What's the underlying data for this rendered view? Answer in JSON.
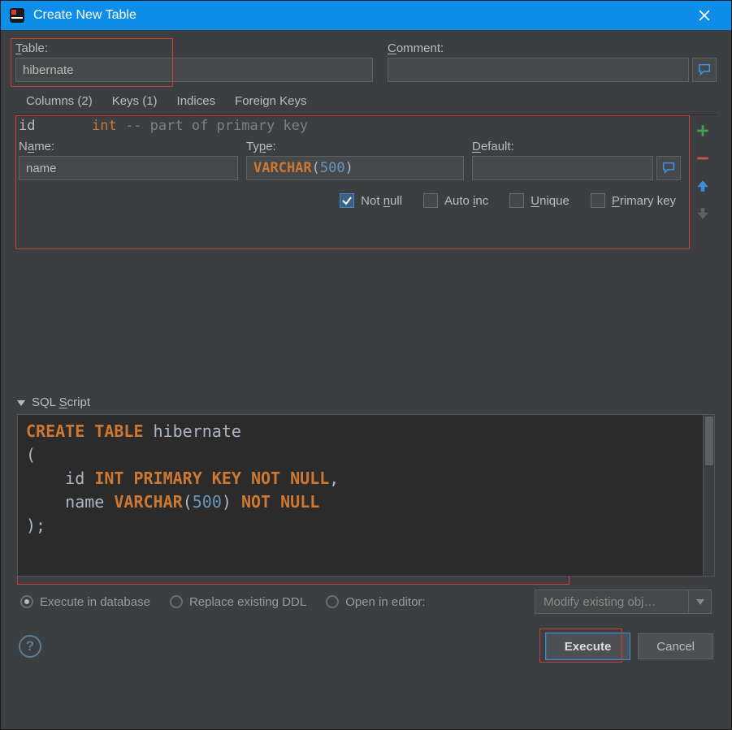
{
  "window": {
    "title": "Create New Table"
  },
  "form": {
    "table_label": "Table:",
    "table_value": "hibernate",
    "comment_label": "Comment:",
    "comment_value": ""
  },
  "tabs": {
    "columns": "Columns (2)",
    "keys": "Keys (1)",
    "indices": "Indices",
    "foreign_keys": "Foreign Keys"
  },
  "hint": {
    "col_name": "id",
    "col_type": "int",
    "col_comment": "-- part of primary key"
  },
  "colfields": {
    "name_label": "Name:",
    "name_value": "name",
    "type_label": "Type:",
    "type_value_html": "VARCHAR(500)",
    "type_kw": "VARCHAR",
    "type_open": "(",
    "type_num": "500",
    "type_close": ")",
    "default_label": "Default:",
    "default_value": ""
  },
  "checks": {
    "not_null": "Not null",
    "auto_inc": "Auto inc",
    "unique": "Unique",
    "primary_key": "Primary key"
  },
  "sql": {
    "header": "SQL Script",
    "kw_create": "CREATE TABLE",
    "tbl": "hibernate",
    "open": "(",
    "line1_ident": "id",
    "line1_rest": "INT PRIMARY KEY NOT NULL",
    "comma": ",",
    "line2_ident": "name",
    "line2_kw": "VARCHAR",
    "line2_open": "(",
    "line2_num": "500",
    "line2_close": ")",
    "line2_rest": "NOT NULL",
    "close": ");"
  },
  "radios": {
    "execute_db": "Execute in database",
    "replace_ddl": "Replace existing DDL",
    "open_editor": "Open in editor:",
    "combo": "Modify existing obj…"
  },
  "footer": {
    "execute": "Execute",
    "cancel": "Cancel"
  }
}
